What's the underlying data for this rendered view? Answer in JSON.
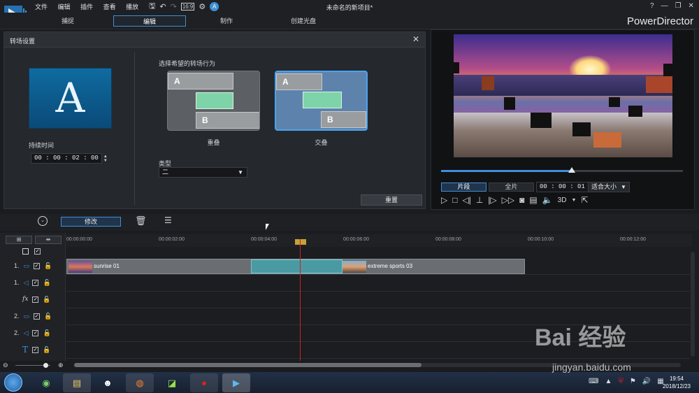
{
  "app": {
    "title": "未命名的新项目*",
    "brand": "PowerDirector",
    "menu": [
      "文件",
      "编辑",
      "插件",
      "查看",
      "播放"
    ],
    "window_buttons": [
      "?",
      "—",
      "❐",
      "✕"
    ]
  },
  "mode_tabs": [
    {
      "label": "捕捉",
      "active": false
    },
    {
      "label": "编辑",
      "active": true
    },
    {
      "label": "制作",
      "active": false
    },
    {
      "label": "创建光盘",
      "active": false
    }
  ],
  "transition_panel": {
    "title": "转场设置",
    "close": "✕",
    "preview_letter": "A",
    "duration_label": "持续时间",
    "duration_value": "00 : 00 : 02 : 00",
    "behavior_label": "选择希望的转场行为",
    "options": [
      {
        "label": "重叠",
        "top": "A",
        "bottom": "B",
        "selected": false
      },
      {
        "label": "交叠",
        "top": "A",
        "bottom": "B",
        "selected": true
      }
    ],
    "type_label": "类型",
    "type_value": "二",
    "reset_label": "重置"
  },
  "preview": {
    "progress": 0.54,
    "segment_buttons": [
      "片段",
      "全片"
    ],
    "timecode": "00 : 00 : 01 : 02",
    "fit_label": "适合大小",
    "mode_3d": "3D"
  },
  "edit_toolbar": {
    "modify_label": "修改"
  },
  "timeline": {
    "ruler": [
      "00:00:00:00",
      "00:00:02:00",
      "00:00:04:00",
      "00:00:06:00",
      "00:00:08:00",
      "00:00:10:00",
      "00:00:12:00"
    ],
    "tracks": [
      {
        "num": "1.",
        "type": "video"
      },
      {
        "num": "1.",
        "type": "audio"
      },
      {
        "num": "",
        "type": "fx",
        "icon": "fx"
      },
      {
        "num": "2.",
        "type": "video"
      },
      {
        "num": "2.",
        "type": "audio"
      },
      {
        "num": "",
        "type": "title",
        "icon": "T"
      }
    ],
    "clips": [
      {
        "name": "sunrise 01"
      },
      {
        "name": "extreme sports 03"
      }
    ]
  },
  "taskbar": {
    "time": "19:54",
    "date": "2018/12/23"
  },
  "watermark": {
    "main": "Bai 经验",
    "sub": "jingyan.baidu.com"
  }
}
